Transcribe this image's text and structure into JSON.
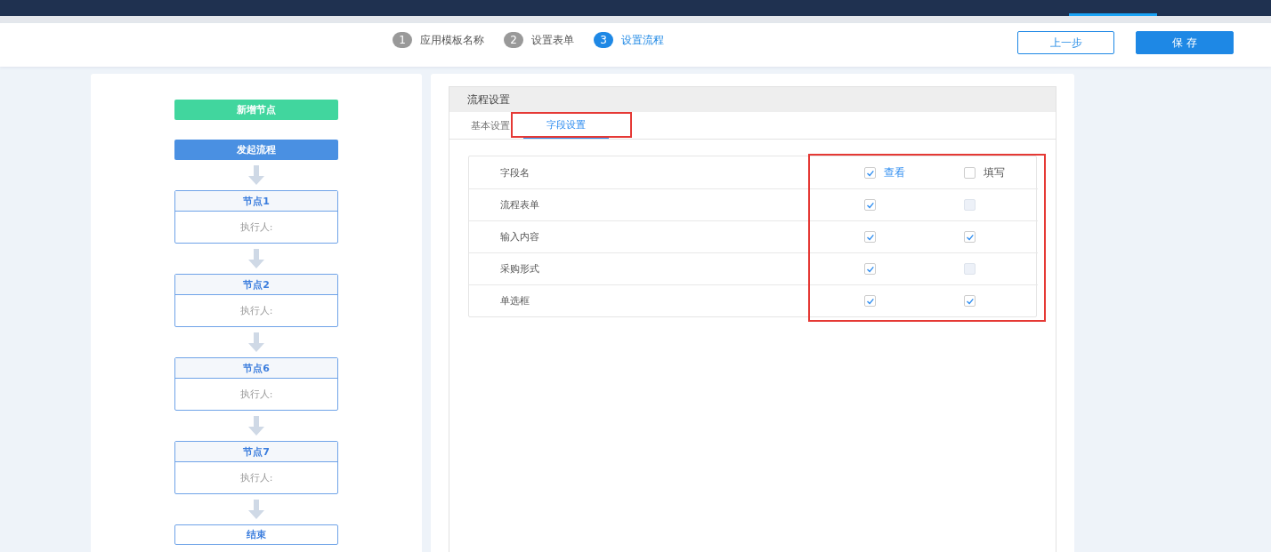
{
  "steps": [
    {
      "number": "1",
      "label": "应用模板名称",
      "selected": false
    },
    {
      "number": "2",
      "label": "设置表单",
      "selected": false
    },
    {
      "number": "3",
      "label": "设置流程",
      "selected": true
    }
  ],
  "header_buttons": [
    {
      "kind": "outline",
      "label": "上一步"
    },
    {
      "kind": "primary",
      "label": "保 存"
    }
  ],
  "flow": {
    "add_button": "新增节点",
    "start": "发起流程",
    "nodes": [
      {
        "title": "节点1",
        "assignee": "执行人:"
      },
      {
        "title": "节点2",
        "assignee": "执行人:"
      },
      {
        "title": "节点6",
        "assignee": "执行人:"
      },
      {
        "title": "节点7",
        "assignee": "执行人:"
      }
    ],
    "end": "结束"
  },
  "settings": {
    "title": "流程设置",
    "tabs": [
      {
        "label": "基本设置",
        "selected": false,
        "annotated": false
      },
      {
        "label": "字段设置",
        "selected": true,
        "annotated": true
      }
    ],
    "table": {
      "columns_annotated": true,
      "columns": [
        {
          "label": "字段名"
        },
        {
          "label": "查看",
          "checked": true
        },
        {
          "label": "填写",
          "checked": false
        }
      ],
      "rows": [
        {
          "name": "流程表单",
          "view": {
            "checked": true,
            "disabled": false
          },
          "write": {
            "checked": false,
            "disabled": true
          }
        },
        {
          "name": "输入内容",
          "view": {
            "checked": true,
            "disabled": false
          },
          "write": {
            "checked": true,
            "disabled": false
          }
        },
        {
          "name": "采购形式",
          "view": {
            "checked": true,
            "disabled": false
          },
          "write": {
            "checked": false,
            "disabled": true
          }
        },
        {
          "name": "单选框",
          "view": {
            "checked": true,
            "disabled": false
          },
          "write": {
            "checked": true,
            "disabled": false
          }
        }
      ]
    }
  }
}
